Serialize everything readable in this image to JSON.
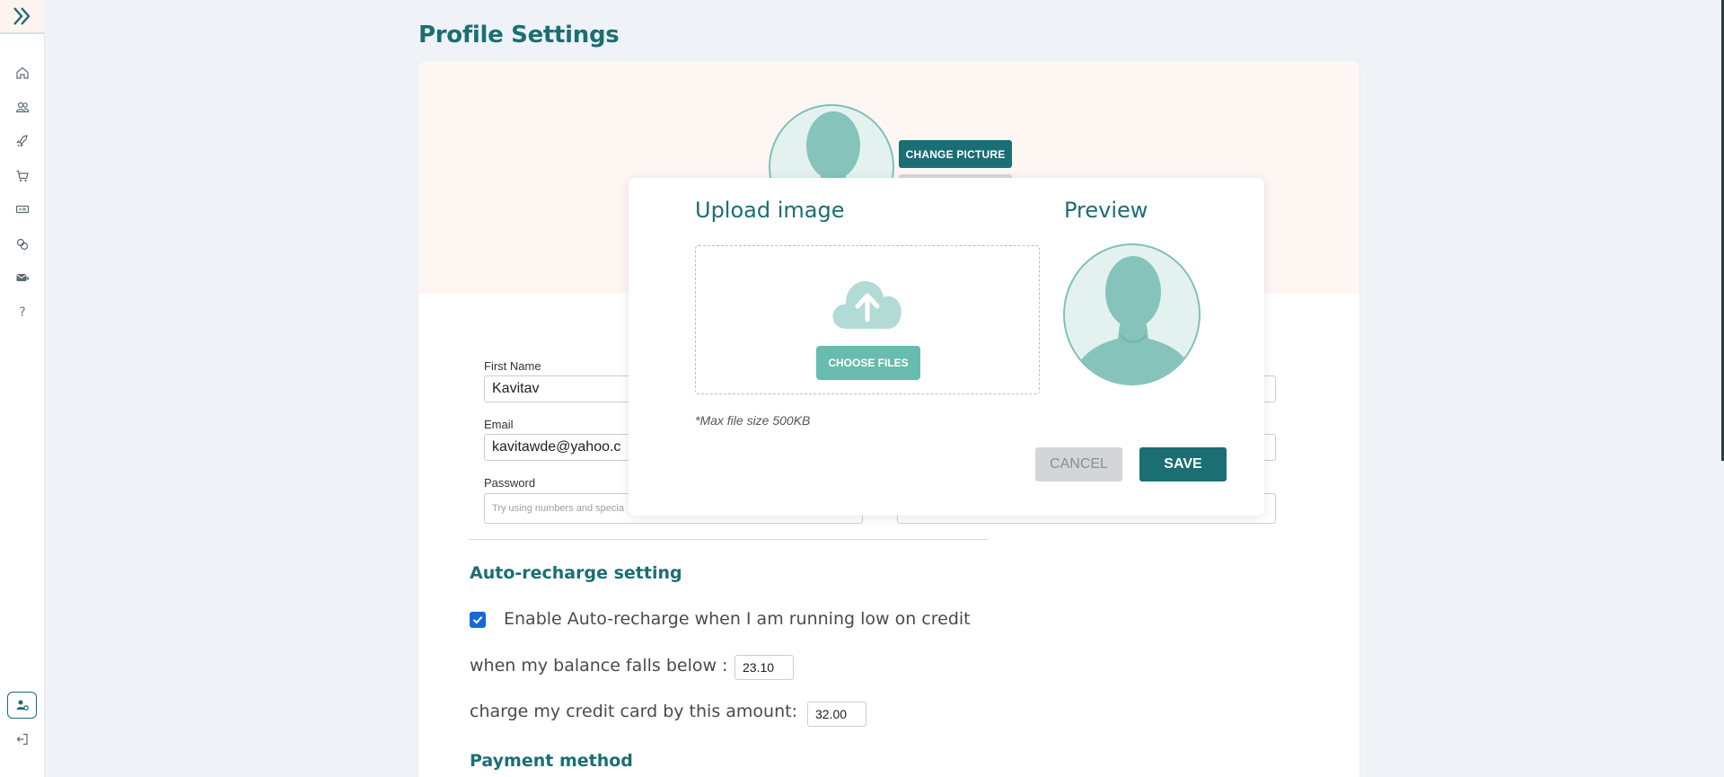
{
  "sidebar": {
    "logo_icon": "double-chevron-right-icon",
    "items": [
      {
        "icon": "home-icon"
      },
      {
        "icon": "users-icon"
      },
      {
        "icon": "rocket-icon"
      },
      {
        "icon": "cart-icon"
      },
      {
        "icon": "ticket-icon"
      },
      {
        "icon": "link-icon"
      },
      {
        "icon": "mail-icon"
      },
      {
        "icon": "help-icon",
        "glyph": "?"
      }
    ],
    "user_icon": "user-settings-icon",
    "logout_icon": "logout-icon"
  },
  "page": {
    "title": "Profile Settings"
  },
  "profile": {
    "change_picture_label": "CHANGE PICTURE"
  },
  "form": {
    "first_name_label": "First Name",
    "first_name_value": "Kavitav",
    "email_label": "Email",
    "email_value": "kavitawde@yahoo.c",
    "password_label": "Password",
    "password_placeholder": "Try using numbers and specia"
  },
  "auto_recharge": {
    "title": "Auto-recharge setting",
    "enable_label": "Enable Auto-recharge when I am running low on credit",
    "enabled": true,
    "balance_label": "when my balance falls below :",
    "balance_value": "23.10",
    "charge_label": "charge my credit card by this amount:",
    "charge_value": "32.00"
  },
  "payment": {
    "title": "Payment method"
  },
  "modal": {
    "upload_title": "Upload image",
    "preview_title": "Preview",
    "choose_files_label": "CHOOSE FILES",
    "max_size_note": "*Max file size 500KB",
    "cancel_label": "CANCEL",
    "save_label": "SAVE",
    "upload_icon": "cloud-upload-icon"
  },
  "colors": {
    "primary": "#1b6e74",
    "accent": "#68bcaf",
    "background": "#eff3f7",
    "checkbox": "#1668d8"
  }
}
